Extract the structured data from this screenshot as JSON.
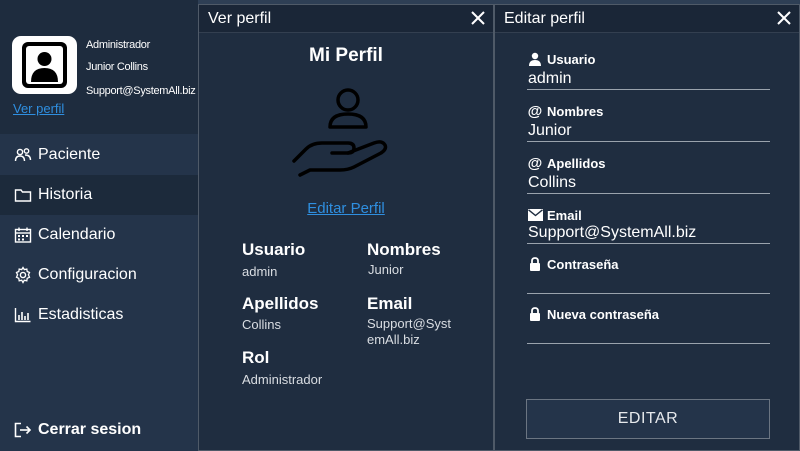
{
  "profile": {
    "role": "Administrador",
    "name": "Junior Collins",
    "email": "Support@SystemAll.biz",
    "link": "Ver perfil"
  },
  "nav": [
    {
      "label": "Paciente",
      "icon": "users-icon"
    },
    {
      "label": "Historia",
      "icon": "folder-icon"
    },
    {
      "label": "Calendario",
      "icon": "calendar-icon"
    },
    {
      "label": "Configuracion",
      "icon": "gear-icon"
    },
    {
      "label": "Estadisticas",
      "icon": "bar-chart-icon"
    }
  ],
  "logout": "Cerrar sesion",
  "view_panel": {
    "title": "Ver perfil",
    "heading": "Mi Perfil",
    "edit_link": "Editar Perfil",
    "fields": {
      "usuario": {
        "label": "Usuario",
        "value": "admin"
      },
      "nombres": {
        "label": "Nombres",
        "value": "Junior"
      },
      "apellidos": {
        "label": "Apellidos",
        "value": "Collins"
      },
      "email": {
        "label": "Email",
        "value_line1": "Support@Syst",
        "value_line2": "emAll.biz"
      },
      "rol": {
        "label": "Rol",
        "value": "Administrador"
      }
    }
  },
  "edit_panel": {
    "title": "Editar perfil",
    "fields": {
      "usuario": {
        "label": "Usuario",
        "value": "admin"
      },
      "nombres": {
        "label": "Nombres",
        "value": "Junior"
      },
      "apellidos": {
        "label": "Apellidos",
        "value": "Collins"
      },
      "email": {
        "label": "Email",
        "value": "Support@SystemAll.biz"
      },
      "password": {
        "label": "Contraseña",
        "value": ""
      },
      "new_password": {
        "label": "Nueva contraseña",
        "value": ""
      }
    },
    "submit": "EDITAR"
  },
  "colors": {
    "sidebar": "#24344a",
    "panel": "#1f2d40",
    "link": "#2f8fe0"
  }
}
